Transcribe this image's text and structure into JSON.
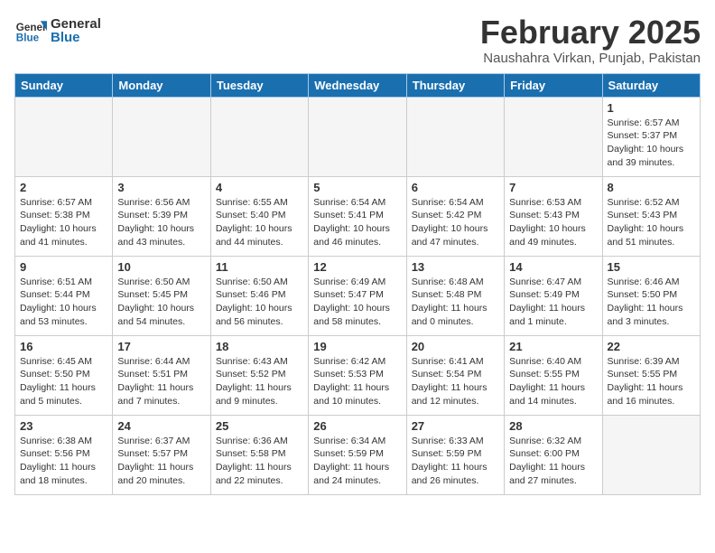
{
  "header": {
    "logo_general": "General",
    "logo_blue": "Blue",
    "month_title": "February 2025",
    "location": "Naushahra Virkan, Punjab, Pakistan"
  },
  "weekdays": [
    "Sunday",
    "Monday",
    "Tuesday",
    "Wednesday",
    "Thursday",
    "Friday",
    "Saturday"
  ],
  "weeks": [
    [
      {
        "day": "",
        "info": ""
      },
      {
        "day": "",
        "info": ""
      },
      {
        "day": "",
        "info": ""
      },
      {
        "day": "",
        "info": ""
      },
      {
        "day": "",
        "info": ""
      },
      {
        "day": "",
        "info": ""
      },
      {
        "day": "1",
        "info": "Sunrise: 6:57 AM\nSunset: 5:37 PM\nDaylight: 10 hours\nand 39 minutes."
      }
    ],
    [
      {
        "day": "2",
        "info": "Sunrise: 6:57 AM\nSunset: 5:38 PM\nDaylight: 10 hours\nand 41 minutes."
      },
      {
        "day": "3",
        "info": "Sunrise: 6:56 AM\nSunset: 5:39 PM\nDaylight: 10 hours\nand 43 minutes."
      },
      {
        "day": "4",
        "info": "Sunrise: 6:55 AM\nSunset: 5:40 PM\nDaylight: 10 hours\nand 44 minutes."
      },
      {
        "day": "5",
        "info": "Sunrise: 6:54 AM\nSunset: 5:41 PM\nDaylight: 10 hours\nand 46 minutes."
      },
      {
        "day": "6",
        "info": "Sunrise: 6:54 AM\nSunset: 5:42 PM\nDaylight: 10 hours\nand 47 minutes."
      },
      {
        "day": "7",
        "info": "Sunrise: 6:53 AM\nSunset: 5:43 PM\nDaylight: 10 hours\nand 49 minutes."
      },
      {
        "day": "8",
        "info": "Sunrise: 6:52 AM\nSunset: 5:43 PM\nDaylight: 10 hours\nand 51 minutes."
      }
    ],
    [
      {
        "day": "9",
        "info": "Sunrise: 6:51 AM\nSunset: 5:44 PM\nDaylight: 10 hours\nand 53 minutes."
      },
      {
        "day": "10",
        "info": "Sunrise: 6:50 AM\nSunset: 5:45 PM\nDaylight: 10 hours\nand 54 minutes."
      },
      {
        "day": "11",
        "info": "Sunrise: 6:50 AM\nSunset: 5:46 PM\nDaylight: 10 hours\nand 56 minutes."
      },
      {
        "day": "12",
        "info": "Sunrise: 6:49 AM\nSunset: 5:47 PM\nDaylight: 10 hours\nand 58 minutes."
      },
      {
        "day": "13",
        "info": "Sunrise: 6:48 AM\nSunset: 5:48 PM\nDaylight: 11 hours\nand 0 minutes."
      },
      {
        "day": "14",
        "info": "Sunrise: 6:47 AM\nSunset: 5:49 PM\nDaylight: 11 hours\nand 1 minute."
      },
      {
        "day": "15",
        "info": "Sunrise: 6:46 AM\nSunset: 5:50 PM\nDaylight: 11 hours\nand 3 minutes."
      }
    ],
    [
      {
        "day": "16",
        "info": "Sunrise: 6:45 AM\nSunset: 5:50 PM\nDaylight: 11 hours\nand 5 minutes."
      },
      {
        "day": "17",
        "info": "Sunrise: 6:44 AM\nSunset: 5:51 PM\nDaylight: 11 hours\nand 7 minutes."
      },
      {
        "day": "18",
        "info": "Sunrise: 6:43 AM\nSunset: 5:52 PM\nDaylight: 11 hours\nand 9 minutes."
      },
      {
        "day": "19",
        "info": "Sunrise: 6:42 AM\nSunset: 5:53 PM\nDaylight: 11 hours\nand 10 minutes."
      },
      {
        "day": "20",
        "info": "Sunrise: 6:41 AM\nSunset: 5:54 PM\nDaylight: 11 hours\nand 12 minutes."
      },
      {
        "day": "21",
        "info": "Sunrise: 6:40 AM\nSunset: 5:55 PM\nDaylight: 11 hours\nand 14 minutes."
      },
      {
        "day": "22",
        "info": "Sunrise: 6:39 AM\nSunset: 5:55 PM\nDaylight: 11 hours\nand 16 minutes."
      }
    ],
    [
      {
        "day": "23",
        "info": "Sunrise: 6:38 AM\nSunset: 5:56 PM\nDaylight: 11 hours\nand 18 minutes."
      },
      {
        "day": "24",
        "info": "Sunrise: 6:37 AM\nSunset: 5:57 PM\nDaylight: 11 hours\nand 20 minutes."
      },
      {
        "day": "25",
        "info": "Sunrise: 6:36 AM\nSunset: 5:58 PM\nDaylight: 11 hours\nand 22 minutes."
      },
      {
        "day": "26",
        "info": "Sunrise: 6:34 AM\nSunset: 5:59 PM\nDaylight: 11 hours\nand 24 minutes."
      },
      {
        "day": "27",
        "info": "Sunrise: 6:33 AM\nSunset: 5:59 PM\nDaylight: 11 hours\nand 26 minutes."
      },
      {
        "day": "28",
        "info": "Sunrise: 6:32 AM\nSunset: 6:00 PM\nDaylight: 11 hours\nand 27 minutes."
      },
      {
        "day": "",
        "info": ""
      }
    ]
  ]
}
